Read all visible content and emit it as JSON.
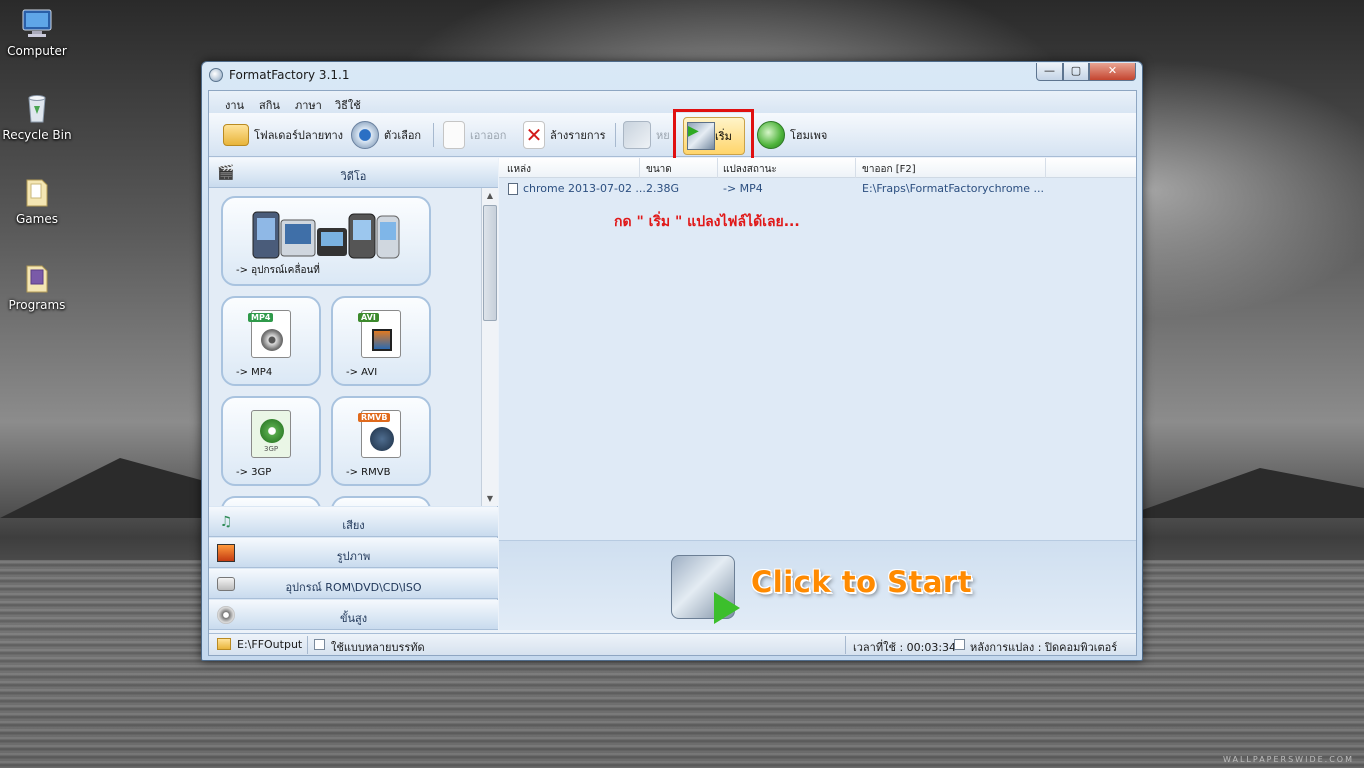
{
  "desktop": {
    "icons": [
      {
        "label": "Computer"
      },
      {
        "label": "Recycle Bin"
      },
      {
        "label": "Games"
      },
      {
        "label": "Programs"
      }
    ],
    "watermark": "WALLPAPERSWIDE.COM"
  },
  "window": {
    "title": "FormatFactory 3.1.1",
    "controls": {
      "minimize": "—",
      "maximize": "▢",
      "close": "✕"
    }
  },
  "menu": {
    "items": [
      "งาน",
      "สกิน",
      "ภาษา",
      "วิธีใช้"
    ]
  },
  "toolbar": {
    "output_folder": "โฟลเดอร์ปลายทาง",
    "options": "ตัวเลือก",
    "remove": "เอาออก",
    "clear_list": "ล้างรายการ",
    "stop": "หย",
    "start": "เริ่ม",
    "homepage": "โฮมเพจ"
  },
  "left_panel": {
    "video_category": "วิดีโอ",
    "tiles": [
      {
        "label": "-> อุปกรณ์เคลื่อนที่"
      },
      {
        "label": "-> MP4",
        "badge": "MP4"
      },
      {
        "label": "-> AVI",
        "badge": "AVI"
      },
      {
        "label": "-> 3GP",
        "badge": "3GP"
      },
      {
        "label": "-> RMVB",
        "badge": "RMVB"
      }
    ],
    "categories": [
      {
        "label": "เสียง",
        "icon": "music-icon"
      },
      {
        "label": "รูปภาพ",
        "icon": "picture-icon"
      },
      {
        "label": "อุปกรณ์ ROM\\DVD\\CD\\ISO",
        "icon": "disc-drive-icon"
      },
      {
        "label": "ขั้นสูง",
        "icon": "advanced-icon"
      }
    ]
  },
  "task_list": {
    "columns": [
      "แหล่ง",
      "ขนาด",
      "แปลงสถานะ",
      "ขาออก [F2]"
    ],
    "rows": [
      {
        "source": "chrome 2013-07-02 ...",
        "size": "2.38G",
        "status": "-> MP4",
        "output": "E:\\Fraps\\FormatFactorychrome ..."
      }
    ],
    "annotation": "กด \" เริ่ม \" แปลงไฟล์ได้เลย..."
  },
  "start_area": {
    "label": "Click to Start"
  },
  "status_bar": {
    "output_path": "E:\\FFOutput",
    "multithread_label": "ใช้แบบหลายบรรทัด",
    "elapsed": "เวลาที่ใช้ : 00:03:34",
    "after_convert": "หลังการแปลง : ปิดคอมพิวเตอร์"
  },
  "colors": {
    "annotation": "#e01818",
    "click_to_start": "#ff8a00",
    "highlight_box": "#e01010"
  }
}
